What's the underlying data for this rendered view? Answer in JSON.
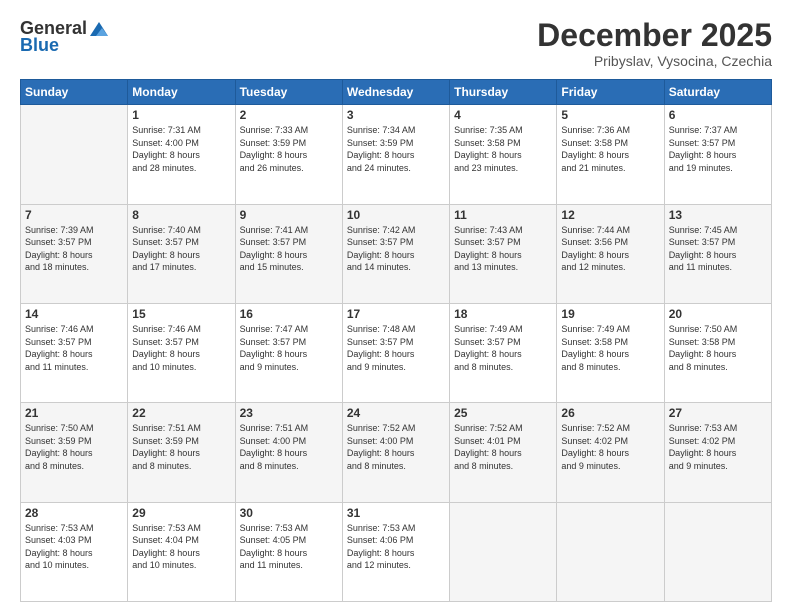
{
  "header": {
    "logo_general": "General",
    "logo_blue": "Blue",
    "month_title": "December 2025",
    "subtitle": "Pribyslav, Vysocina, Czechia"
  },
  "days_of_week": [
    "Sunday",
    "Monday",
    "Tuesday",
    "Wednesday",
    "Thursday",
    "Friday",
    "Saturday"
  ],
  "weeks": [
    [
      {
        "day": "",
        "info": ""
      },
      {
        "day": "1",
        "info": "Sunrise: 7:31 AM\nSunset: 4:00 PM\nDaylight: 8 hours\nand 28 minutes."
      },
      {
        "day": "2",
        "info": "Sunrise: 7:33 AM\nSunset: 3:59 PM\nDaylight: 8 hours\nand 26 minutes."
      },
      {
        "day": "3",
        "info": "Sunrise: 7:34 AM\nSunset: 3:59 PM\nDaylight: 8 hours\nand 24 minutes."
      },
      {
        "day": "4",
        "info": "Sunrise: 7:35 AM\nSunset: 3:58 PM\nDaylight: 8 hours\nand 23 minutes."
      },
      {
        "day": "5",
        "info": "Sunrise: 7:36 AM\nSunset: 3:58 PM\nDaylight: 8 hours\nand 21 minutes."
      },
      {
        "day": "6",
        "info": "Sunrise: 7:37 AM\nSunset: 3:57 PM\nDaylight: 8 hours\nand 19 minutes."
      }
    ],
    [
      {
        "day": "7",
        "info": "Sunrise: 7:39 AM\nSunset: 3:57 PM\nDaylight: 8 hours\nand 18 minutes."
      },
      {
        "day": "8",
        "info": "Sunrise: 7:40 AM\nSunset: 3:57 PM\nDaylight: 8 hours\nand 17 minutes."
      },
      {
        "day": "9",
        "info": "Sunrise: 7:41 AM\nSunset: 3:57 PM\nDaylight: 8 hours\nand 15 minutes."
      },
      {
        "day": "10",
        "info": "Sunrise: 7:42 AM\nSunset: 3:57 PM\nDaylight: 8 hours\nand 14 minutes."
      },
      {
        "day": "11",
        "info": "Sunrise: 7:43 AM\nSunset: 3:57 PM\nDaylight: 8 hours\nand 13 minutes."
      },
      {
        "day": "12",
        "info": "Sunrise: 7:44 AM\nSunset: 3:56 PM\nDaylight: 8 hours\nand 12 minutes."
      },
      {
        "day": "13",
        "info": "Sunrise: 7:45 AM\nSunset: 3:57 PM\nDaylight: 8 hours\nand 11 minutes."
      }
    ],
    [
      {
        "day": "14",
        "info": "Sunrise: 7:46 AM\nSunset: 3:57 PM\nDaylight: 8 hours\nand 11 minutes."
      },
      {
        "day": "15",
        "info": "Sunrise: 7:46 AM\nSunset: 3:57 PM\nDaylight: 8 hours\nand 10 minutes."
      },
      {
        "day": "16",
        "info": "Sunrise: 7:47 AM\nSunset: 3:57 PM\nDaylight: 8 hours\nand 9 minutes."
      },
      {
        "day": "17",
        "info": "Sunrise: 7:48 AM\nSunset: 3:57 PM\nDaylight: 8 hours\nand 9 minutes."
      },
      {
        "day": "18",
        "info": "Sunrise: 7:49 AM\nSunset: 3:57 PM\nDaylight: 8 hours\nand 8 minutes."
      },
      {
        "day": "19",
        "info": "Sunrise: 7:49 AM\nSunset: 3:58 PM\nDaylight: 8 hours\nand 8 minutes."
      },
      {
        "day": "20",
        "info": "Sunrise: 7:50 AM\nSunset: 3:58 PM\nDaylight: 8 hours\nand 8 minutes."
      }
    ],
    [
      {
        "day": "21",
        "info": "Sunrise: 7:50 AM\nSunset: 3:59 PM\nDaylight: 8 hours\nand 8 minutes."
      },
      {
        "day": "22",
        "info": "Sunrise: 7:51 AM\nSunset: 3:59 PM\nDaylight: 8 hours\nand 8 minutes."
      },
      {
        "day": "23",
        "info": "Sunrise: 7:51 AM\nSunset: 4:00 PM\nDaylight: 8 hours\nand 8 minutes."
      },
      {
        "day": "24",
        "info": "Sunrise: 7:52 AM\nSunset: 4:00 PM\nDaylight: 8 hours\nand 8 minutes."
      },
      {
        "day": "25",
        "info": "Sunrise: 7:52 AM\nSunset: 4:01 PM\nDaylight: 8 hours\nand 8 minutes."
      },
      {
        "day": "26",
        "info": "Sunrise: 7:52 AM\nSunset: 4:02 PM\nDaylight: 8 hours\nand 9 minutes."
      },
      {
        "day": "27",
        "info": "Sunrise: 7:53 AM\nSunset: 4:02 PM\nDaylight: 8 hours\nand 9 minutes."
      }
    ],
    [
      {
        "day": "28",
        "info": "Sunrise: 7:53 AM\nSunset: 4:03 PM\nDaylight: 8 hours\nand 10 minutes."
      },
      {
        "day": "29",
        "info": "Sunrise: 7:53 AM\nSunset: 4:04 PM\nDaylight: 8 hours\nand 10 minutes."
      },
      {
        "day": "30",
        "info": "Sunrise: 7:53 AM\nSunset: 4:05 PM\nDaylight: 8 hours\nand 11 minutes."
      },
      {
        "day": "31",
        "info": "Sunrise: 7:53 AM\nSunset: 4:06 PM\nDaylight: 8 hours\nand 12 minutes."
      },
      {
        "day": "",
        "info": ""
      },
      {
        "day": "",
        "info": ""
      },
      {
        "day": "",
        "info": ""
      }
    ]
  ]
}
